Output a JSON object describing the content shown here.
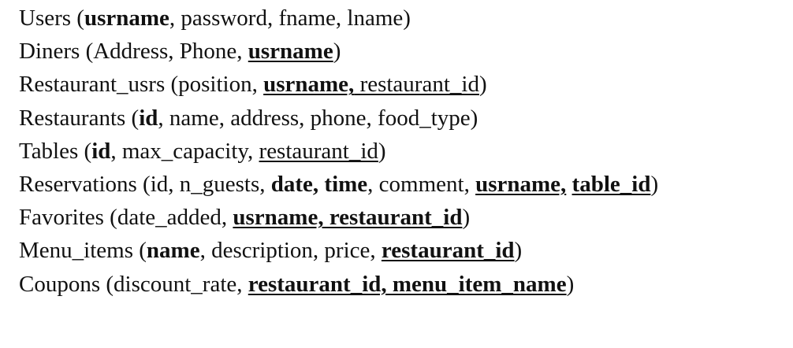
{
  "lines": [
    [
      {
        "t": "Users ("
      },
      {
        "t": "usrname",
        "b": true
      },
      {
        "t": ", password, fname, lname)"
      }
    ],
    [
      {
        "t": "Diners (Address, Phone, "
      },
      {
        "t": "usrname",
        "b": true,
        "u": true
      },
      {
        "t": ")"
      }
    ],
    [
      {
        "t": "Restaurant_usrs (position, "
      },
      {
        "t": "usrname,",
        "b": true,
        "u": true
      },
      {
        "t": " restaurant_id",
        "u": true
      },
      {
        "t": ")"
      }
    ],
    [
      {
        "t": "Restaurants ("
      },
      {
        "t": "id",
        "b": true
      },
      {
        "t": ", name, address, phone, food_type)"
      }
    ],
    [
      {
        "t": "Tables ("
      },
      {
        "t": "id",
        "b": true
      },
      {
        "t": ", max_capacity, "
      },
      {
        "t": "restaurant_id",
        "u": true
      },
      {
        "t": ")"
      }
    ],
    [
      {
        "t": "Reservations (id, n_guests, "
      },
      {
        "t": "date, time",
        "b": true
      },
      {
        "t": ", comment, "
      },
      {
        "t": "usrname,",
        "b": true,
        "u": true
      },
      {
        "t": " "
      },
      {
        "t": "table_id",
        "b": true,
        "u": true
      },
      {
        "t": ")"
      }
    ],
    [
      {
        "t": "Favorites (date_added, "
      },
      {
        "t": "usrname, restaurant_id",
        "b": true,
        "u": true
      },
      {
        "t": ")"
      }
    ],
    [
      {
        "t": "Menu_items ("
      },
      {
        "t": "name",
        "b": true
      },
      {
        "t": ", description, price, "
      },
      {
        "t": "restaurant_id",
        "b": true,
        "u": true
      },
      {
        "t": ")"
      }
    ],
    [
      {
        "t": "Coupons (discount_rate, "
      },
      {
        "t": "restaurant_id, menu_item_name",
        "b": true,
        "u": true
      },
      {
        "t": ")"
      }
    ]
  ]
}
